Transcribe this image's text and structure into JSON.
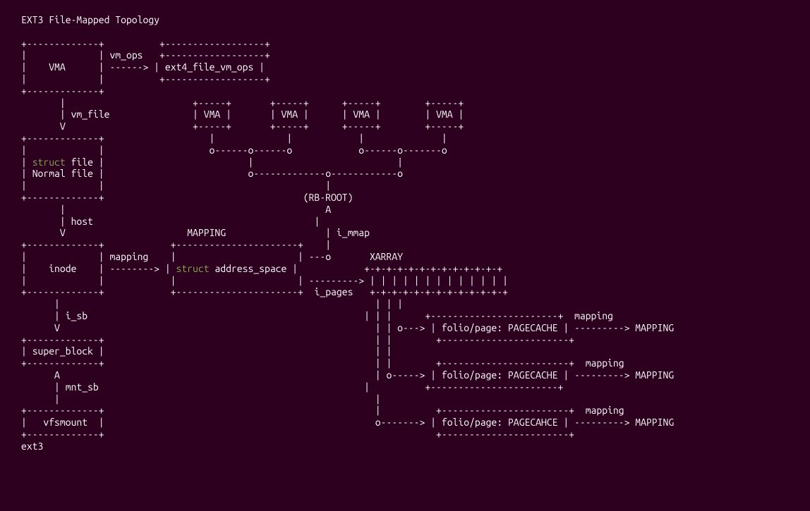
{
  "title": "EXT3 File-Mapped Topology",
  "boxes": {
    "vma": "VMA",
    "vm_ops_label": "vm_ops",
    "ext4_ops": "ext4_file_vm_ops",
    "vm_file": "vm_file",
    "struct_kw": "struct",
    "file_label": "file",
    "normal_file": "Normal file",
    "host": "host",
    "inode": "inode",
    "mapping_label": "mapping",
    "mapping_header": "MAPPING",
    "address_space": "address_space",
    "i_mmap": "i_mmap",
    "rb_root": "(RB-ROOT)",
    "xarray": "XARRAY",
    "i_pages": "i_pages",
    "i_sb": "i_sb",
    "super_block": "super_block",
    "mnt_sb": "mnt_sb",
    "vfsmount": "vfsmount",
    "ext3": "ext3",
    "folio_page_pagecache": "folio/page: PAGECACHE",
    "folio_page_pagecahce": "folio/page: PAGECAHCE",
    "mapping_out": "mapping",
    "mapping_target": "MAPPING"
  }
}
